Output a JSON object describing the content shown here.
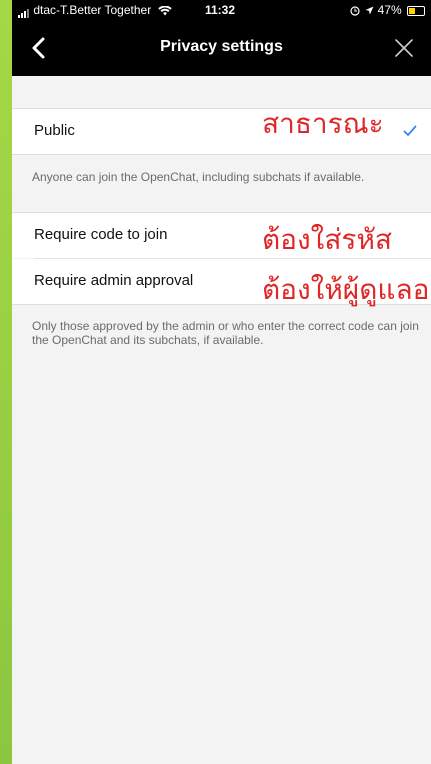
{
  "status_bar": {
    "carrier": "dtac-T.Better Together",
    "time": "11:32",
    "battery": "47%"
  },
  "nav": {
    "title": "Privacy settings"
  },
  "options": {
    "public": {
      "label": "Public",
      "selected": true,
      "annotation": "สาธารณะ"
    },
    "public_desc": "Anyone can join the OpenChat, including subchats if available.",
    "code": {
      "label": "Require code to join",
      "annotation": "ต้องใส่รหัส"
    },
    "approval": {
      "label": "Require admin approval",
      "annotation": "ต้องให้ผู้ดูแลอ"
    },
    "restricted_desc": "Only those approved by the admin or who enter the correct code can join the OpenChat and its subchats, if available."
  },
  "colors": {
    "accent_check": "#3b82f6",
    "annotation_red": "#e02626",
    "background_green": "#9bd03a"
  }
}
